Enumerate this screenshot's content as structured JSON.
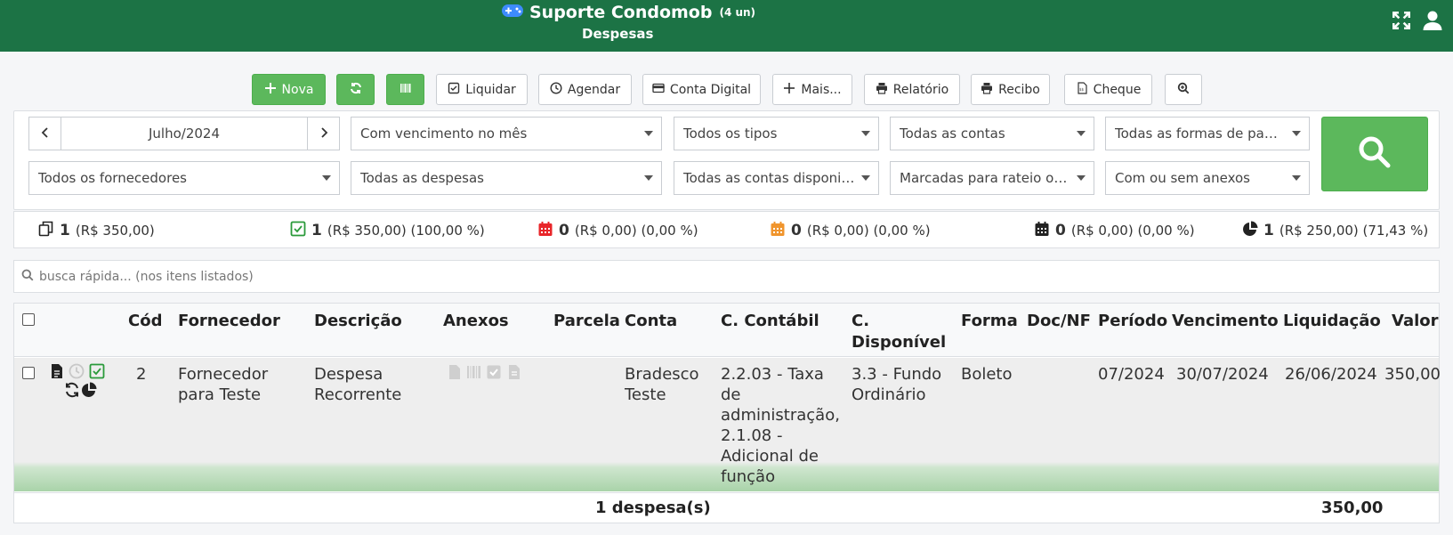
{
  "header": {
    "app_title": "Suporte Condomob",
    "units": "(4 un)",
    "subtitle": "Despesas"
  },
  "toolbar": {
    "nova": "Nova",
    "liquidar": "Liquidar",
    "agendar": "Agendar",
    "conta_digital": "Conta Digital",
    "mais": "Mais...",
    "relatorio": "Relatório",
    "recibo": "Recibo",
    "cheque": "Cheque"
  },
  "filters": {
    "month": "Julho/2024",
    "vencimento": "Com vencimento no mês",
    "tipos": "Todos os tipos",
    "contas": "Todas as contas",
    "formas": "Todas as formas de pagamento",
    "fornecedores": "Todos os fornecedores",
    "despesas": "Todas as despesas",
    "contas_disp": "Todas as contas disponibilizadas",
    "rateio": "Marcadas para rateio ou não",
    "anexos": "Com ou sem anexos"
  },
  "summary": {
    "total": {
      "count": "1",
      "detail": "(R$ 350,00)"
    },
    "liquidadas": {
      "count": "1",
      "detail": "(R$ 350,00) (100,00 %)"
    },
    "vencidas": {
      "count": "0",
      "detail": "(R$ 0,00) (0,00 %)"
    },
    "a_vencer": {
      "count": "0",
      "detail": "(R$ 0,00) (0,00 %)"
    },
    "agendadas": {
      "count": "0",
      "detail": "(R$ 0,00) (0,00 %)"
    },
    "rateio": {
      "count": "1",
      "detail": "(R$ 250,00) (71,43 %)"
    }
  },
  "quick_search": {
    "placeholder": "busca rápida... (nos itens listados)"
  },
  "table": {
    "headers": {
      "cod": "Cód",
      "fornecedor": "Fornecedor",
      "descricao": "Descrição",
      "anexos": "Anexos",
      "parcela": "Parcela",
      "conta": "Conta",
      "c_contabil": "C. Contábil",
      "c_disponivel_1": "C.",
      "c_disponivel_2": "Disponível",
      "forma": "Forma",
      "doc_nf": "Doc/NF",
      "periodo": "Período",
      "vencimento": "Vencimento",
      "liquidacao": "Liquidação",
      "valor": "Valor"
    },
    "rows": [
      {
        "cod": "2",
        "fornecedor_1": "Fornecedor",
        "fornecedor_2": "para Teste",
        "descricao_1": "Despesa",
        "descricao_2": "Recorrente",
        "conta_1": "Bradesco",
        "conta_2": "Teste",
        "c_contabil": [
          "2.2.03 - Taxa",
          "de",
          "administração,",
          "2.1.08 -",
          "Adicional de",
          "função"
        ],
        "c_disponivel_1": "3.3 - Fundo",
        "c_disponivel_2": "Ordinário",
        "forma": "Boleto",
        "periodo": "07/2024",
        "vencimento": "30/07/2024",
        "liquidacao": "26/06/2024",
        "valor": "350,00"
      }
    ],
    "footer": {
      "count": "1 despesa(s)",
      "total": "350,00"
    }
  },
  "colors": {
    "header": "#1c7345",
    "success": "#5cb85c",
    "danger": "#e8262a",
    "warning": "#f0952d"
  }
}
